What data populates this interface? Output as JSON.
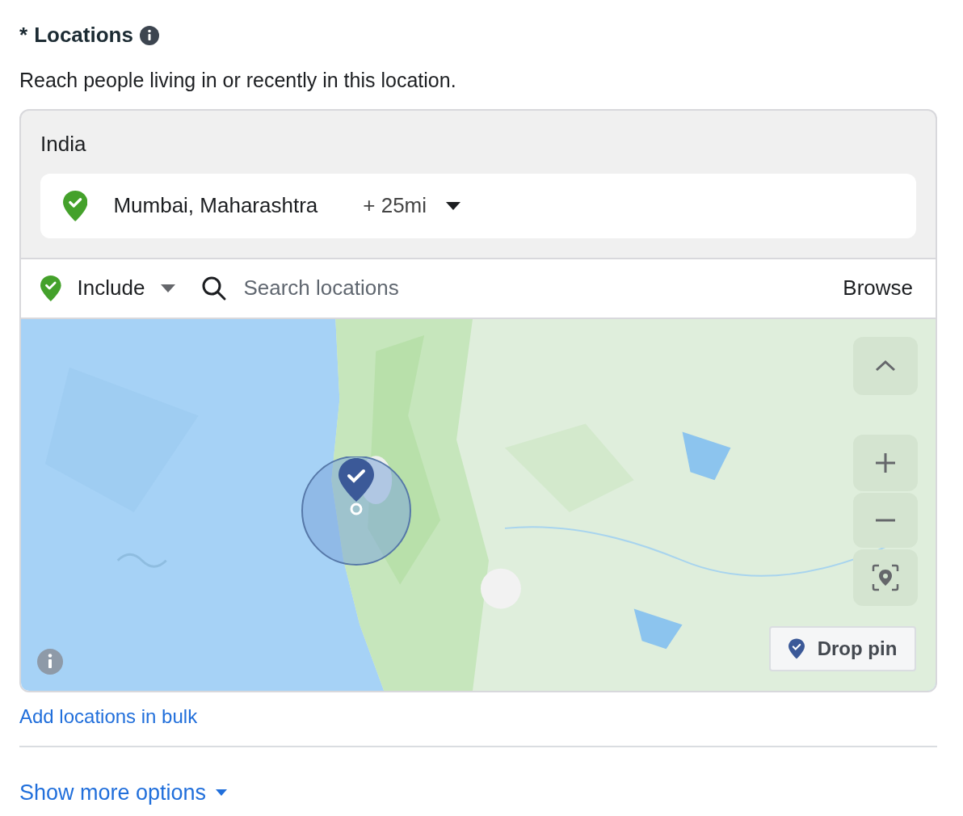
{
  "heading": {
    "required_mark": "*",
    "title": "Locations"
  },
  "description": "Reach people living in or recently in this location.",
  "country": "India",
  "selected_locations": [
    {
      "name": "Mumbai, Maharashtra",
      "radius": "+ 25mi",
      "included": true
    }
  ],
  "search_bar": {
    "mode": "Include",
    "included": true,
    "placeholder": "Search locations",
    "browse": "Browse"
  },
  "map": {
    "kind": "picture",
    "drop_pin": "Drop pin"
  },
  "bulk_link": "Add locations in bulk",
  "more_options": "Show more options"
}
